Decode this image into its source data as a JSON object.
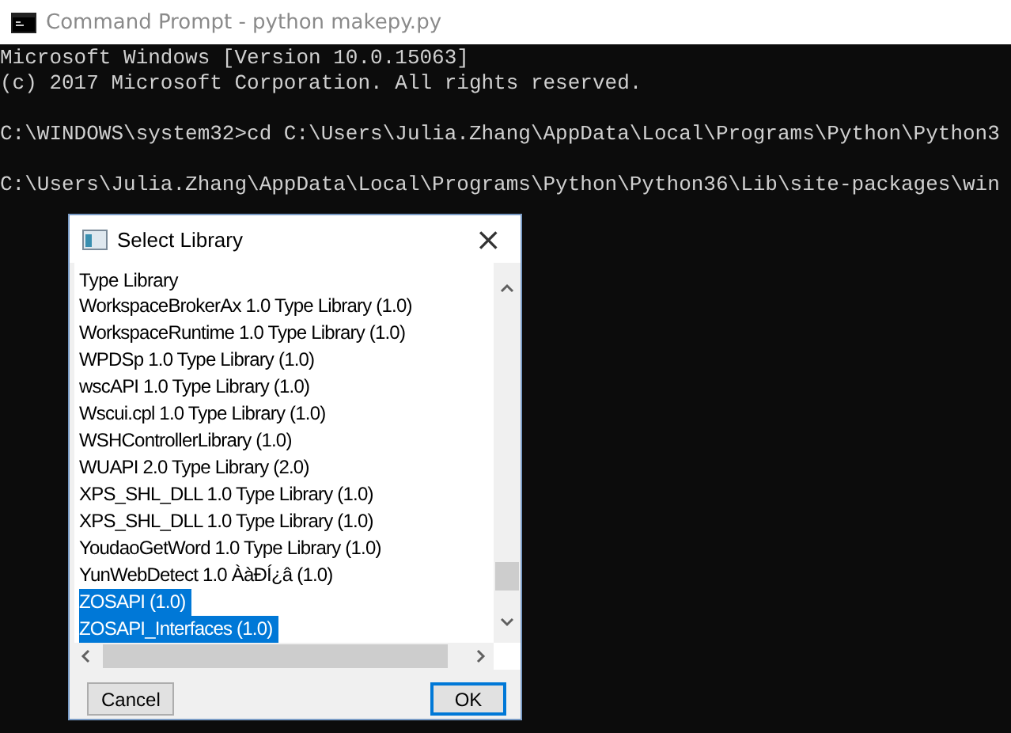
{
  "window": {
    "title": "Command Prompt - python  makepy.py"
  },
  "console_blocks": [
    [
      "Microsoft Windows [Version 10.0.15063]",
      "(c) 2017 Microsoft Corporation. All rights reserved."
    ],
    [
      "C:\\WINDOWS\\system32>cd C:\\Users\\Julia.Zhang\\AppData\\Local\\Programs\\Python\\Python3"
    ],
    [
      "C:\\Users\\Julia.Zhang\\AppData\\Local\\Programs\\Python\\Python36\\Lib\\site-packages\\win"
    ]
  ],
  "dialog": {
    "title": "Select Library",
    "close": "×",
    "list_header": "Type Library",
    "items": [
      {
        "label": "WorkspaceBrokerAx 1.0 Type Library (1.0)",
        "selected": false
      },
      {
        "label": "WorkspaceRuntime 1.0 Type Library (1.0)",
        "selected": false
      },
      {
        "label": "WPDSp 1.0 Type Library (1.0)",
        "selected": false
      },
      {
        "label": "wscAPI 1.0 Type Library (1.0)",
        "selected": false
      },
      {
        "label": "Wscui.cpl 1.0 Type Library (1.0)",
        "selected": false
      },
      {
        "label": "WSHControllerLibrary (1.0)",
        "selected": false
      },
      {
        "label": "WUAPI 2.0 Type Library (2.0)",
        "selected": false
      },
      {
        "label": "XPS_SHL_DLL 1.0 Type Library (1.0)",
        "selected": false
      },
      {
        "label": "XPS_SHL_DLL 1.0 Type Library (1.0)",
        "selected": false
      },
      {
        "label": "YoudaoGetWord 1.0 Type Library (1.0)",
        "selected": false
      },
      {
        "label": "YunWebDetect 1.0 ÀàÐÍ¿â (1.0)",
        "selected": false
      },
      {
        "label": "ZOSAPI (1.0)",
        "selected": true
      },
      {
        "label": "ZOSAPI_Interfaces (1.0)",
        "selected": true
      }
    ],
    "buttons": [
      "Cancel",
      "OK"
    ]
  }
}
